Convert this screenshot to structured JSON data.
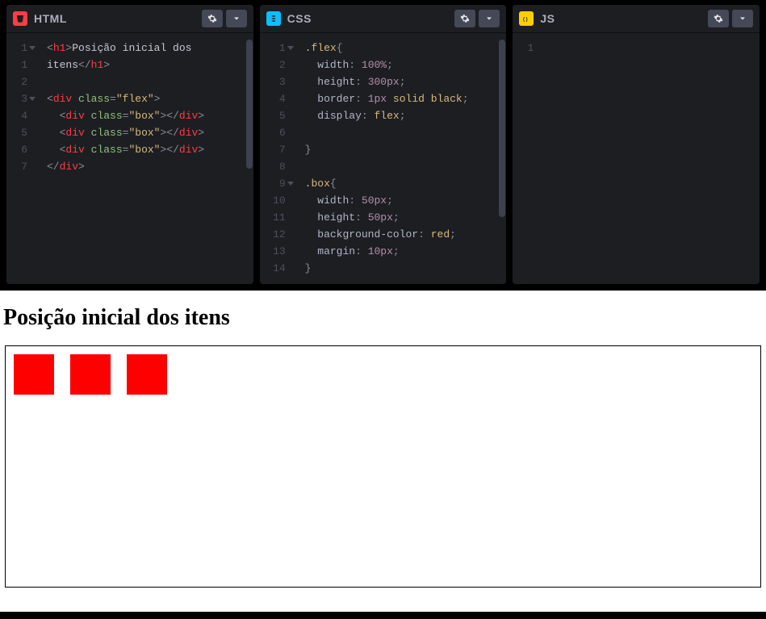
{
  "panels": {
    "html": {
      "title": "HTML",
      "badge_color": "#ff3c41",
      "code_tokens": [
        [
          [
            "<",
            "punc"
          ],
          [
            "h1",
            "tag"
          ],
          [
            ">",
            "punc"
          ],
          [
            "Posição inicial dos ",
            "text"
          ]
        ],
        [
          [
            "itens",
            "text"
          ],
          [
            "</",
            "punc"
          ],
          [
            "h1",
            "tag"
          ],
          [
            ">",
            "punc"
          ]
        ],
        [],
        [
          [
            "<",
            "punc"
          ],
          [
            "div ",
            "tag"
          ],
          [
            "class",
            "attr"
          ],
          [
            "=",
            "punc"
          ],
          [
            "\"flex\"",
            "str"
          ],
          [
            ">",
            "punc"
          ]
        ],
        [
          [
            "  ",
            "text"
          ],
          [
            "<",
            "punc"
          ],
          [
            "div ",
            "tag"
          ],
          [
            "class",
            "attr"
          ],
          [
            "=",
            "punc"
          ],
          [
            "\"box\"",
            "str"
          ],
          [
            "></",
            "punc"
          ],
          [
            "div",
            "tag"
          ],
          [
            ">",
            "punc"
          ]
        ],
        [
          [
            "  ",
            "text"
          ],
          [
            "<",
            "punc"
          ],
          [
            "div ",
            "tag"
          ],
          [
            "class",
            "attr"
          ],
          [
            "=",
            "punc"
          ],
          [
            "\"box\"",
            "str"
          ],
          [
            "></",
            "punc"
          ],
          [
            "div",
            "tag"
          ],
          [
            ">",
            "punc"
          ]
        ],
        [
          [
            "  ",
            "text"
          ],
          [
            "<",
            "punc"
          ],
          [
            "div ",
            "tag"
          ],
          [
            "class",
            "attr"
          ],
          [
            "=",
            "punc"
          ],
          [
            "\"box\"",
            "str"
          ],
          [
            "></",
            "punc"
          ],
          [
            "div",
            "tag"
          ],
          [
            ">",
            "punc"
          ]
        ],
        [
          [
            "</",
            "punc"
          ],
          [
            "div",
            "tag"
          ],
          [
            ">",
            "punc"
          ]
        ]
      ],
      "line_numbers": [
        "1",
        "1",
        "2",
        "3",
        "4",
        "5",
        "6",
        "7"
      ],
      "fold_lines": [
        0,
        3
      ]
    },
    "css": {
      "title": "CSS",
      "badge_color": "#0ebeff",
      "code_tokens": [
        [
          [
            ".flex",
            "sel"
          ],
          [
            "{",
            "punc"
          ]
        ],
        [
          [
            "  width",
            "prop"
          ],
          [
            ": ",
            "punc"
          ],
          [
            "100%",
            "num"
          ],
          [
            ";",
            "punc"
          ]
        ],
        [
          [
            "  height",
            "prop"
          ],
          [
            ": ",
            "punc"
          ],
          [
            "300px",
            "num"
          ],
          [
            ";",
            "punc"
          ]
        ],
        [
          [
            "  border",
            "prop"
          ],
          [
            ": ",
            "punc"
          ],
          [
            "1px",
            "num"
          ],
          [
            " ",
            "text"
          ],
          [
            "solid black",
            "val"
          ],
          [
            ";",
            "punc"
          ]
        ],
        [
          [
            "  display",
            "prop"
          ],
          [
            ": ",
            "punc"
          ],
          [
            "flex",
            "val"
          ],
          [
            ";",
            "punc"
          ]
        ],
        [],
        [
          [
            "}",
            "punc"
          ]
        ],
        [],
        [
          [
            ".box",
            "sel"
          ],
          [
            "{",
            "punc"
          ]
        ],
        [
          [
            "  width",
            "prop"
          ],
          [
            ": ",
            "punc"
          ],
          [
            "50px",
            "num"
          ],
          [
            ";",
            "punc"
          ]
        ],
        [
          [
            "  height",
            "prop"
          ],
          [
            ": ",
            "punc"
          ],
          [
            "50px",
            "num"
          ],
          [
            ";",
            "punc"
          ]
        ],
        [
          [
            "  background-color",
            "prop"
          ],
          [
            ": ",
            "punc"
          ],
          [
            "red",
            "val"
          ],
          [
            ";",
            "punc"
          ]
        ],
        [
          [
            "  margin",
            "prop"
          ],
          [
            ": ",
            "punc"
          ],
          [
            "10px",
            "num"
          ],
          [
            ";",
            "punc"
          ]
        ],
        [
          [
            "}",
            "punc"
          ]
        ]
      ],
      "line_numbers": [
        "1",
        "2",
        "3",
        "4",
        "5",
        "6",
        "7",
        "8",
        "9",
        "10",
        "11",
        "12",
        "13",
        "14"
      ],
      "fold_lines": [
        0,
        8
      ]
    },
    "js": {
      "title": "JS",
      "badge_color": "#fcd000",
      "code_tokens": [
        []
      ],
      "line_numbers": [
        "1"
      ],
      "fold_lines": []
    }
  },
  "output": {
    "heading": "Posição inicial dos itens",
    "box_count": 3
  }
}
